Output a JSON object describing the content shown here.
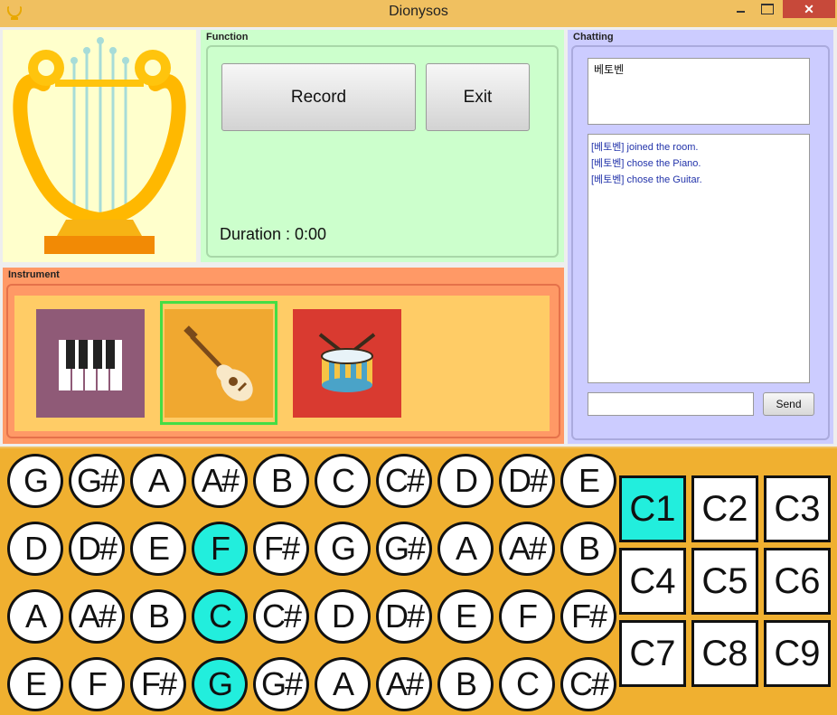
{
  "window": {
    "title": "Dionysos",
    "close_glyph": "✕"
  },
  "function_panel": {
    "label": "Function",
    "record_label": "Record",
    "exit_label": "Exit",
    "duration_label": "Duration : 0:00"
  },
  "instrument_panel": {
    "label": "Instrument",
    "selected": "guitar"
  },
  "chat_panel": {
    "label": "Chatting",
    "input_text": "베토벤",
    "log": [
      "[베토벤] joined the room.",
      "[베토벤] chose the Piano.",
      "[베토벤] chose the Guitar."
    ],
    "send_label": "Send",
    "message_value": ""
  },
  "notes": [
    [
      "G",
      "G#",
      "A",
      "A#",
      "B",
      "C",
      "C#",
      "D",
      "D#",
      "E"
    ],
    [
      "D",
      "D#",
      "E",
      "F",
      "F#",
      "G",
      "G#",
      "A",
      "A#",
      "B"
    ],
    [
      "A",
      "A#",
      "B",
      "C",
      "C#",
      "D",
      "D#",
      "E",
      "F",
      "F#"
    ],
    [
      "E",
      "F",
      "F#",
      "G",
      "G#",
      "A",
      "A#",
      "B",
      "C",
      "C#"
    ]
  ],
  "active_notes": [
    [
      1,
      3
    ],
    [
      2,
      3
    ],
    [
      3,
      3
    ]
  ],
  "chords": [
    "C1",
    "C2",
    "C3",
    "C4",
    "C5",
    "C6",
    "C7",
    "C8",
    "C9"
  ],
  "active_chord": "C1",
  "colors": {
    "highlight": "#22eedd",
    "guitar_selection": "#44dd44"
  }
}
